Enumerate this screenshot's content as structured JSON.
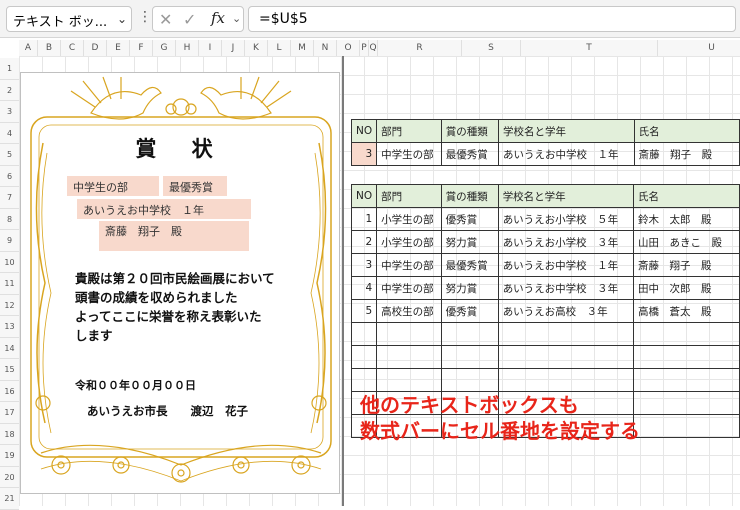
{
  "formula_bar": {
    "name_box": "テキスト ボッ...",
    "fx_label": "fx",
    "formula": "=$U$5"
  },
  "columns": [
    "A",
    "B",
    "C",
    "D",
    "E",
    "F",
    "G",
    "H",
    "I",
    "J",
    "K",
    "L",
    "M",
    "N",
    "O",
    "P",
    "Q",
    "R",
    "S",
    "T",
    "U"
  ],
  "rows": [
    "1",
    "2",
    "3",
    "4",
    "5",
    "6",
    "7",
    "8",
    "9",
    "10",
    "11",
    "12",
    "13",
    "14",
    "15",
    "16",
    "17",
    "18",
    "19",
    "20",
    "21"
  ],
  "certificate": {
    "title": "賞 状",
    "department": "中学生の部",
    "award": "最優秀賞",
    "school": "あいうえお中学校　１年",
    "name": "斎藤　翔子　殿",
    "body": [
      "貴殿は第２０回市民絵画展において",
      "頭書の成績を収められました",
      "よってここに栄誉を称え表彰いた",
      "します"
    ],
    "date": "令和００年００月００日",
    "signer": "あいうえお市長　　渡辺　花子"
  },
  "headers": {
    "no": "NO",
    "dept": "部門",
    "award": "賞の種類",
    "school": "学校名と学年",
    "name": "氏名"
  },
  "selected_row": {
    "no": "3",
    "dept": "中学生の部",
    "award": "最優秀賞",
    "school": "あいうえお中学校　１年",
    "name": "斎藤　翔子　殿"
  },
  "records": [
    {
      "no": "1",
      "dept": "小学生の部",
      "award": "優秀賞",
      "school": "あいうえお小学校　５年",
      "name": "鈴木　太郎　殿"
    },
    {
      "no": "2",
      "dept": "小学生の部",
      "award": "努力賞",
      "school": "あいうえお小学校　３年",
      "name": "山田　あきこ　殿"
    },
    {
      "no": "3",
      "dept": "中学生の部",
      "award": "最優秀賞",
      "school": "あいうえお中学校　１年",
      "name": "斎藤　翔子　殿"
    },
    {
      "no": "4",
      "dept": "中学生の部",
      "award": "努力賞",
      "school": "あいうえお中学校　３年",
      "name": "田中　次郎　殿"
    },
    {
      "no": "5",
      "dept": "高校生の部",
      "award": "優秀賞",
      "school": "あいうえお高校　３年",
      "name": "高橋　蒼太　殿"
    }
  ],
  "empty_rows": 5,
  "annotation": [
    "他のテキストボックスも",
    "数式バーにセル番地を設定する"
  ],
  "colors": {
    "header_fill": "#e2efda",
    "textbox_fill": "#f8d9cc",
    "annotation": "#e8251a",
    "frame_gold": "#d9a520"
  }
}
